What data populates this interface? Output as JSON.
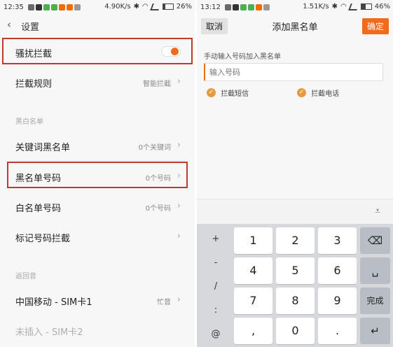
{
  "left": {
    "status": {
      "time": "12:35",
      "speed": "4.90K/s",
      "battery": "26%"
    },
    "header": {
      "title": "设置"
    },
    "rows": [
      {
        "label": "骚扰拦截"
      },
      {
        "label": "拦截规则",
        "value": "智能拦截"
      },
      {
        "label": "关键词黑名单",
        "value": "0个关键词"
      },
      {
        "label": "黑名单号码",
        "value": "0个号码"
      },
      {
        "label": "白名单号码",
        "value": "0个号码"
      },
      {
        "label": "标记号码拦截"
      },
      {
        "label": "中国移动 - SIM卡1",
        "value": "忙音"
      },
      {
        "label": "未插入 - SIM卡2"
      }
    ],
    "sections": {
      "blackwhite": "黑白名单",
      "busytone": "返回音"
    },
    "toggle_on": true
  },
  "right": {
    "status": {
      "time": "13:12",
      "speed": "1.51K/s",
      "battery": "46%"
    },
    "header": {
      "cancel": "取消",
      "title": "添加黑名单",
      "confirm": "确定"
    },
    "form": {
      "label": "手动输入号码加入黑名单",
      "placeholder": "输入号码",
      "opt_sms": "拦截短信",
      "opt_call": "拦截电话"
    },
    "keyboard": {
      "symbols": [
        "+",
        "-",
        "/",
        ":",
        "@"
      ],
      "digits": [
        "1",
        "2",
        "3",
        "4",
        "5",
        "6",
        "7",
        "8",
        "9",
        ",",
        "0",
        "."
      ],
      "done": "完成"
    }
  },
  "colors": {
    "accent": "#f26b1d",
    "check": "#e69b43",
    "highlight": "#c0392b"
  }
}
